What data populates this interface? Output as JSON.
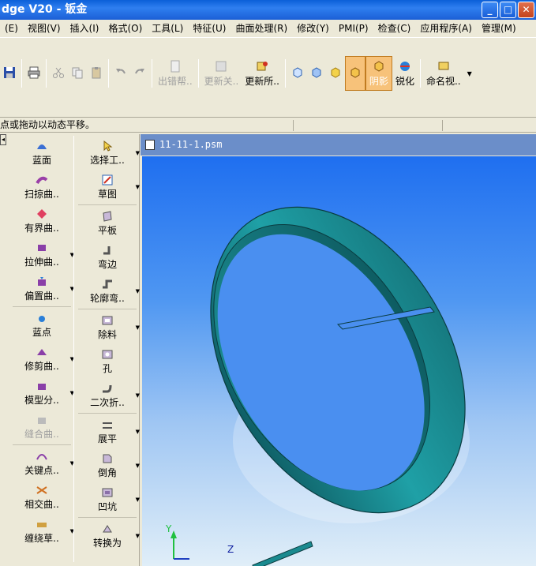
{
  "window": {
    "title": "dge V20 - 钣金",
    "min": "_",
    "max": "□",
    "close": "✕"
  },
  "menu": [
    "(E)",
    "视图(V)",
    "插入(I)",
    "格式(O)",
    "工具(L)",
    "特征(U)",
    "曲面处理(R)",
    "修改(Y)",
    "PMI(P)",
    "检查(C)",
    "应用程序(A)",
    "管理(M)"
  ],
  "toolbar": {
    "help": "出错帮..",
    "update_rel": "更新关..",
    "update_all": "更新所..",
    "shade": "阴影",
    "sharpen": "锐化",
    "named_views": "命名视.."
  },
  "status": {
    "hint": "点或拖动以动态平移。"
  },
  "left_col1": [
    "蓝面",
    "扫掠曲..",
    "有界曲..",
    "拉伸曲..",
    "偏置曲..",
    "蓝点",
    "修剪曲..",
    "模型分..",
    "缝合曲..",
    "关键点..",
    "相交曲..",
    "缠绕草.."
  ],
  "left_col2": [
    "选择工..",
    "草图",
    "平板",
    "弯边",
    "轮廓弯..",
    "除料",
    "孔",
    "二次折..",
    "展平",
    "倒角",
    "凹坑",
    "转换为"
  ],
  "document": {
    "tab": "11-11-1.psm"
  },
  "axes": {
    "y": "Y",
    "z": "Z"
  },
  "colors": {
    "ring": "#1f8f94",
    "ring_dark": "#13696f",
    "title": "#0a5fd8",
    "bg": "#ece9d8"
  }
}
